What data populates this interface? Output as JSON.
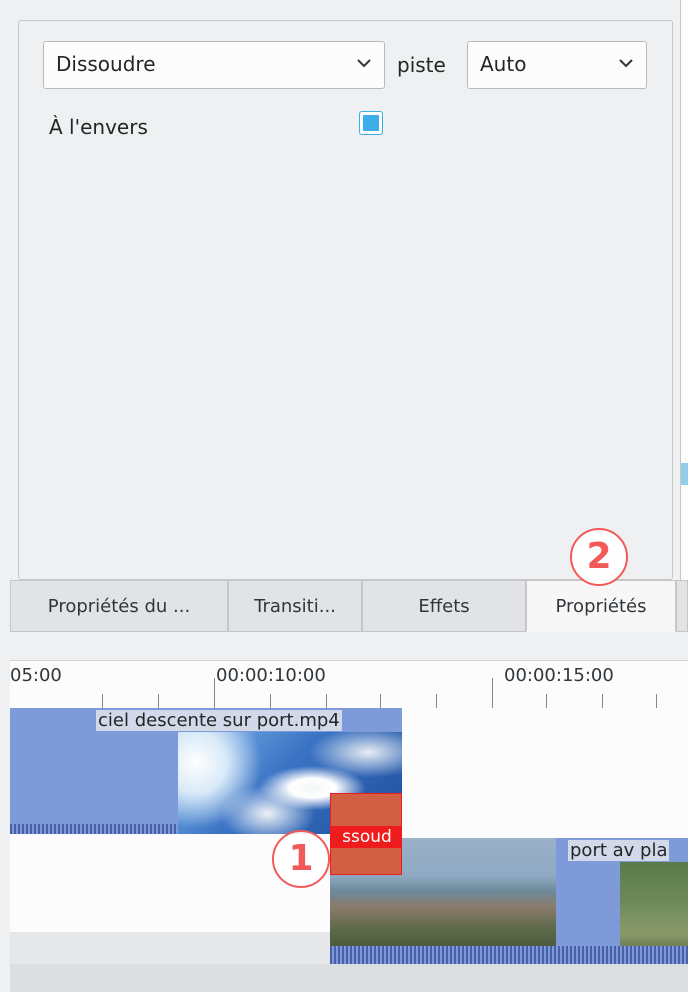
{
  "properties_panel": {
    "transition_select": {
      "value": "Dissoudre"
    },
    "track_label": "piste",
    "track_select": {
      "value": "Auto"
    },
    "reverse_label": "À l'envers",
    "reverse_checked": true
  },
  "tabs": [
    {
      "label": "Propriétés du ...",
      "active": false
    },
    {
      "label": "Transiti...",
      "active": false
    },
    {
      "label": "Effets",
      "active": false
    },
    {
      "label": "Propriétés",
      "active": true
    },
    {
      "label": "",
      "active": false
    }
  ],
  "timeline": {
    "ruler_labels": [
      "05:00",
      "00:00:10:00",
      "00:00:15:00"
    ],
    "clips": [
      {
        "title": "ciel descente sur port.mp4",
        "track": 1
      },
      {
        "title": "port av pla",
        "track": 2
      }
    ],
    "transition_label": "ssoud"
  },
  "annotations": [
    "1",
    "2"
  ],
  "colors": {
    "clip_blue": "#7f9ad8",
    "transition_red": "#ee1c1c",
    "annotation_red": "#f25a5a",
    "checkbox_blue": "#3daee9"
  }
}
